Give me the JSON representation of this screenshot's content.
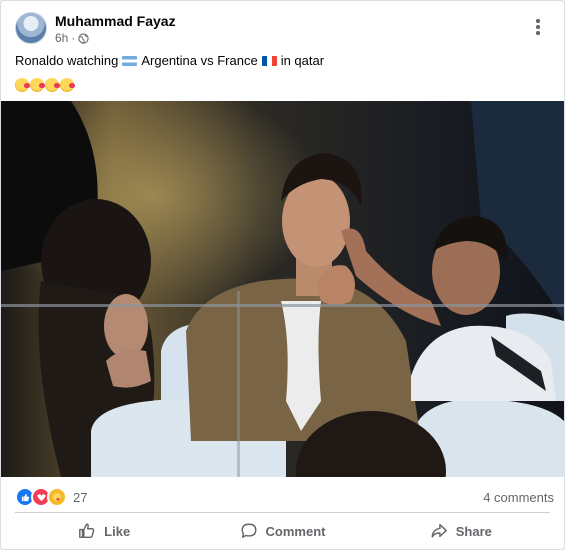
{
  "post": {
    "author": "Muhammad Fayaz",
    "time": "6h",
    "privacy_icon": "globe-icon",
    "caption": {
      "part1": "Ronaldo watching",
      "part2": "Argentina vs France",
      "part3": "in qatar"
    },
    "emoji_reactions_in_text": [
      "smiling-face-with-hearts",
      "smiling-face-with-hearts",
      "smiling-face-with-hearts",
      "smiling-face-with-hearts"
    ]
  },
  "stats": {
    "reaction_icons": [
      "like-icon",
      "love-icon",
      "care-icon"
    ],
    "reaction_count": "27",
    "comments": "4 comments"
  },
  "actions": {
    "like_label": "Like",
    "comment_label": "Comment",
    "share_label": "Share"
  },
  "colors": {
    "like_blue": "#1877f2",
    "love_red": "#f33e58",
    "care_yellow": "#f7b928",
    "meta_gray": "#65676b"
  }
}
